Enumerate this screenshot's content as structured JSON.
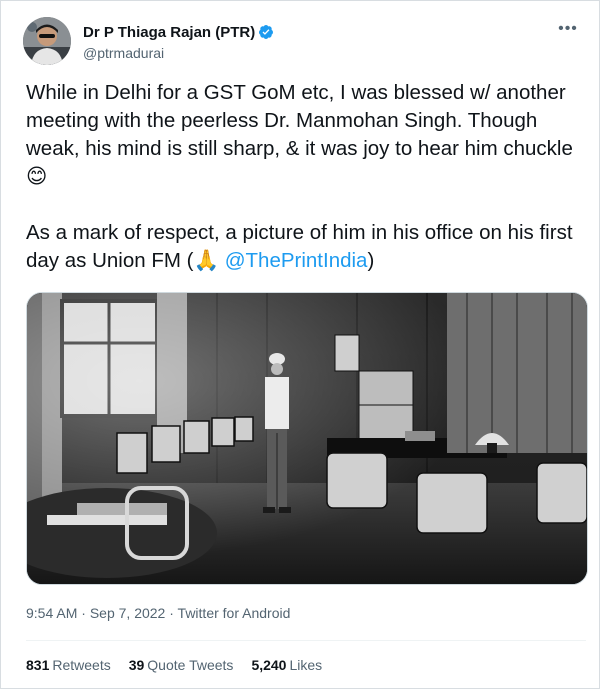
{
  "author": {
    "display_name": "Dr P Thiaga Rajan (PTR)",
    "handle": "@ptrmadurai",
    "verified": true,
    "verified_color": "#1d9bf0"
  },
  "tweet": {
    "para1": "While in Delhi for a GST GoM etc, I was blessed w/ another meeting with the peerless Dr. Manmohan Singh. Though weak, his mind is still sharp, & it was joy to hear him chuckle",
    "para1_emoji": "😊",
    "para2_text": "As a mark of respect, a picture of him in his office on his first day as Union FM (",
    "para2_emoji": "🙏",
    "mention": "@ThePrintIndia",
    "para2_close": ")"
  },
  "meta": {
    "time": "9:54 AM",
    "sep1": " · ",
    "date": "Sep 7, 2022",
    "sep2": " · ",
    "source": "Twitter for Android"
  },
  "stats": {
    "retweets_count": "831",
    "retweets_label": "Retweets",
    "quotes_count": "39",
    "quotes_label": "Quote Tweets",
    "likes_count": "5,240",
    "likes_label": "Likes"
  },
  "colors": {
    "link": "#1d9bf0",
    "secondary_text": "#536471",
    "primary_text": "#0f1419"
  },
  "icons": {
    "verified": "verified-badge-icon",
    "more": "more-options-icon"
  }
}
